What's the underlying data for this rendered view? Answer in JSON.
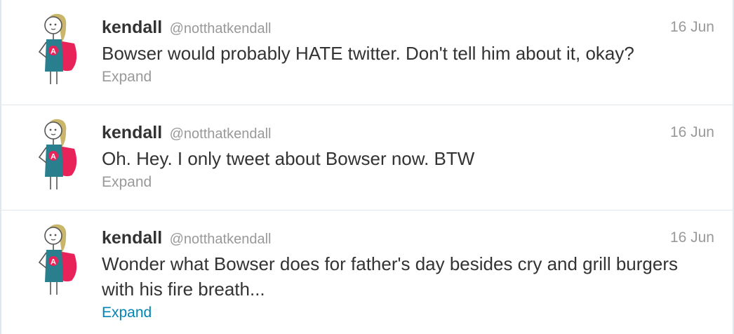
{
  "tweets": [
    {
      "fullname": "kendall",
      "username": "@notthatkendall",
      "time": "16 Jun",
      "text": "Bowser would probably HATE twitter. Don't tell him about it, okay?",
      "expand": "Expand"
    },
    {
      "fullname": "kendall",
      "username": "@notthatkendall",
      "time": "16 Jun",
      "text": "Oh. Hey. I only tweet about Bowser now. BTW",
      "expand": "Expand"
    },
    {
      "fullname": "kendall",
      "username": "@notthatkendall",
      "time": "16 Jun",
      "text": "Wonder what Bowser does for father's day besides cry and grill burgers with his fire breath...",
      "expand": "Expand"
    }
  ],
  "colors": {
    "name": "#333333",
    "muted": "#999999",
    "link_active": "#0084b4",
    "cape": "#e8235a",
    "dress": "#2a7f8f",
    "hair": "#c9b66a"
  },
  "avatar_icon": "stick-figure-superhero-avatar-icon"
}
